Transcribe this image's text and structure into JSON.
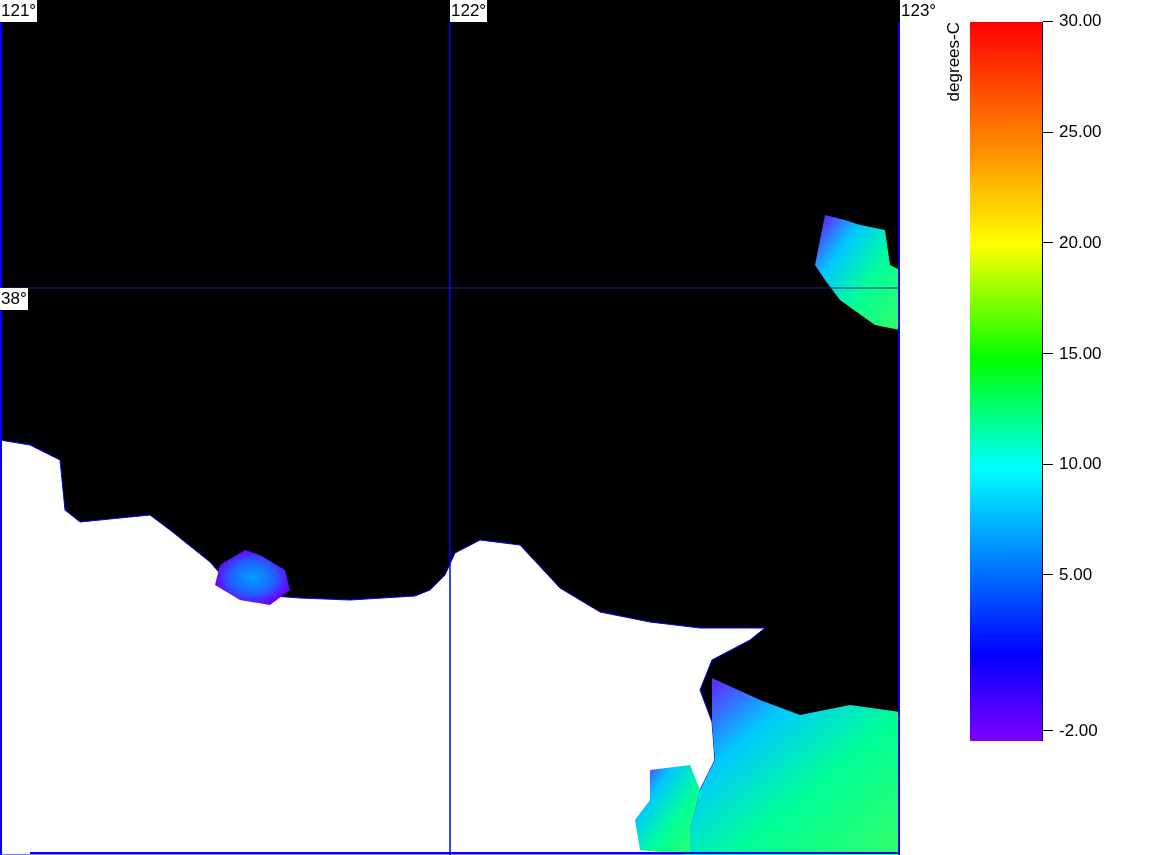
{
  "map": {
    "longitude_labels": [
      "121°",
      "122°",
      "123°"
    ],
    "latitude_labels": [
      "38°"
    ]
  },
  "colorbar": {
    "unit": "degrees-C",
    "ticks": [
      "30.00",
      "25.00",
      "20.00",
      "15.00",
      "10.00",
      "5.00",
      "-2.00"
    ]
  }
}
